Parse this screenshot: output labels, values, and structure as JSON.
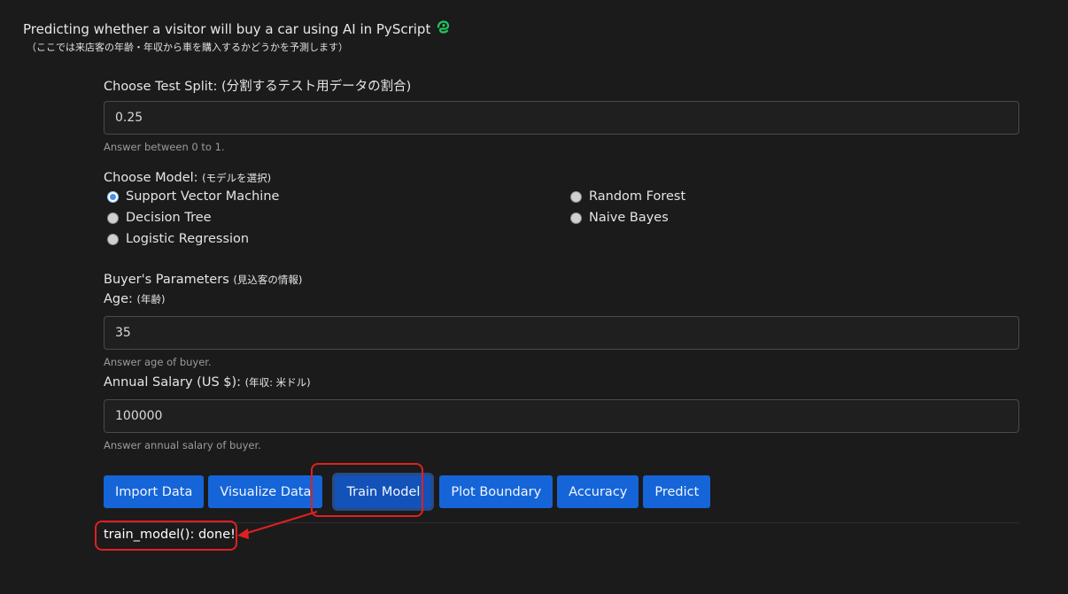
{
  "header": {
    "title": "Predicting whether a visitor will buy a car using AI in PyScript",
    "subtitle": "（ここでは来店客の年齢・年収から車を購入するかどうかを予測します）"
  },
  "test_split": {
    "label": "Choose Test Split:",
    "label_jp": "(分割するテスト用データの割合)",
    "value": "0.25",
    "help": "Answer between 0 to 1."
  },
  "model": {
    "label": "Choose Model:",
    "label_jp": "(モデルを選択)",
    "options": [
      {
        "label": "Support Vector Machine",
        "checked": true
      },
      {
        "label": "Decision Tree",
        "checked": false
      },
      {
        "label": "Logistic Regression",
        "checked": false
      },
      {
        "label": "Random Forest",
        "checked": false
      },
      {
        "label": "Naive Bayes",
        "checked": false
      }
    ]
  },
  "buyer": {
    "label": "Buyer's Parameters",
    "label_jp": "(見込客の情報)",
    "age_label": "Age:",
    "age_label_jp": "(年齢)",
    "age_value": "35",
    "age_help": "Answer age of buyer.",
    "salary_label": "Annual Salary (US $):",
    "salary_label_jp": "(年収: 米ドル)",
    "salary_value": "100000",
    "salary_help": "Answer annual salary of buyer."
  },
  "buttons": {
    "import": "Import Data",
    "visualize": "Visualize Data",
    "train": "Train Model",
    "plot": "Plot Boundary",
    "accuracy": "Accuracy",
    "predict": "Predict"
  },
  "output": {
    "text": "train_model(): done!"
  },
  "colors": {
    "background": "#1b1b1c",
    "button": "#1565d8",
    "callout": "#e02020",
    "logo": "#22c55e"
  },
  "icons": {
    "logo": "pyscript-logo-icon"
  }
}
